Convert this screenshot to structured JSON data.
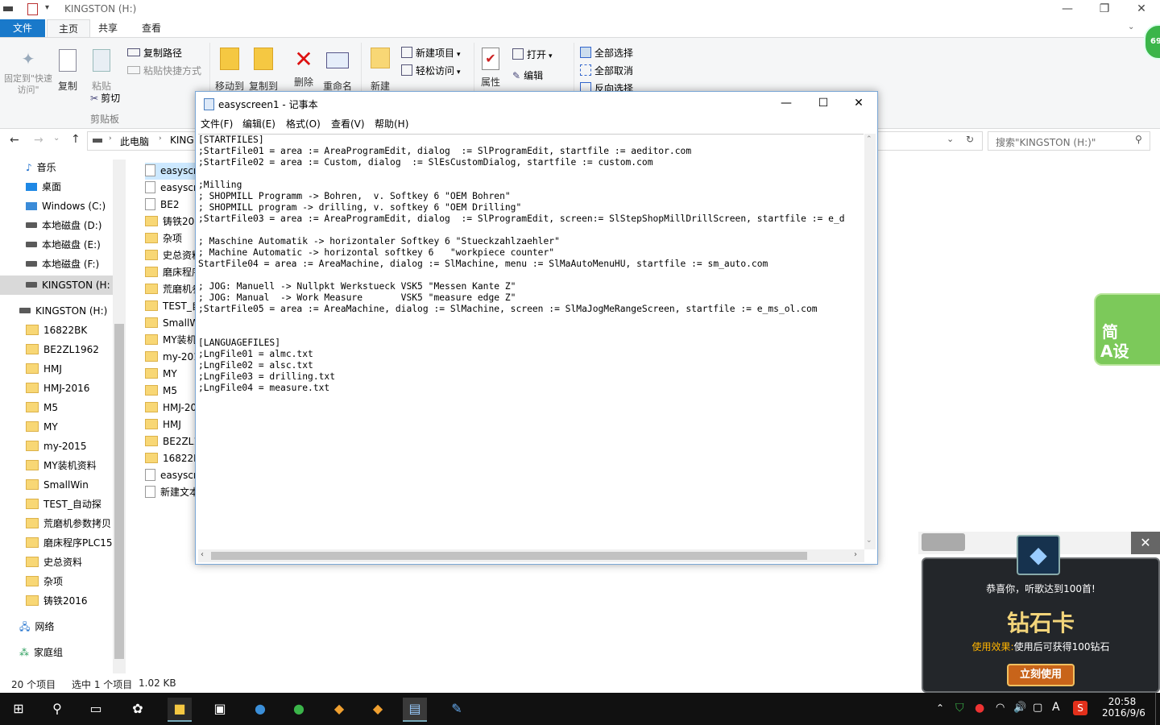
{
  "explorer": {
    "title": "KINGSTON (H:)",
    "tabs": [
      "文件",
      "主页",
      "共享",
      "查看"
    ],
    "ribbon": {
      "pin_quick_access": "固定到\"快速访问\"",
      "copy": "复制",
      "paste": "粘贴",
      "copy_path": "复制路径",
      "paste_shortcut": "粘贴快捷方式",
      "cut": "剪切",
      "clipboard_group": "剪贴板",
      "move_to": "移动到",
      "copy_to": "复制到",
      "delete": "删除",
      "rename": "重命名",
      "new_folder": "新建",
      "new_item": "新建项目",
      "easy_access": "轻松访问",
      "properties": "属性",
      "open": "打开",
      "edit": "编辑",
      "select_all": "全部选择",
      "select_none": "全部取消",
      "invert": "反向选择"
    },
    "address": {
      "pc": "此电脑",
      "drive": "KING"
    },
    "search_placeholder": "搜索\"KINGSTON (H:)\"",
    "nav": [
      {
        "label": "音乐",
        "kind": "music"
      },
      {
        "label": "桌面",
        "kind": "desktop"
      },
      {
        "label": "Windows (C:)",
        "kind": "drive"
      },
      {
        "label": "本地磁盘 (D:)",
        "kind": "drive"
      },
      {
        "label": "本地磁盘 (E:)",
        "kind": "drive"
      },
      {
        "label": "本地磁盘 (F:)",
        "kind": "drive"
      },
      {
        "label": "KINGSTON (H:",
        "kind": "drive"
      }
    ],
    "nav_tree": {
      "root": "KINGSTON (H:)",
      "children": [
        "16822BK",
        "BE2ZL1962",
        "HMJ",
        "HMJ-2016",
        "M5",
        "MY",
        "my-2015",
        "MY装机资料",
        "SmallWin",
        "TEST_自动探",
        "荒磨机参数拷贝",
        "磨床程序PLC15",
        "史总资料",
        "杂项",
        "铸铁2016"
      ],
      "network": "网络",
      "homegroup": "家庭组"
    },
    "files": [
      "easyscr",
      "easyscr",
      "BE2",
      "铸铁201",
      "杂项",
      "史总资料",
      "磨床程序",
      "荒磨机参",
      "TEST_自",
      "SmallWi",
      "MY装机",
      "my-2015",
      "MY",
      "M5",
      "HMJ-20",
      "HMJ",
      "BE2ZL19",
      "16822BI",
      "easyscr",
      "新建文本"
    ],
    "status": {
      "count": "20 个项目",
      "selected": "选中 1 个项目",
      "size": "1.02 KB"
    }
  },
  "notepad": {
    "title": "easyscreen1 - 记事本",
    "menu": [
      "文件(F)",
      "编辑(E)",
      "格式(O)",
      "查看(V)",
      "帮助(H)"
    ],
    "lines": [
      "[STARTFILES]",
      ";StartFile01 = area := AreaProgramEdit, dialog  := SlProgramEdit, startfile := aeditor.com",
      ";StartFile02 = area := Custom, dialog  := SlEsCustomDialog, startfile := custom.com",
      "",
      ";Milling",
      "; SHOPMILL Programm -> Bohren,  v. Softkey 6 \"OEM Bohren\"",
      "; SHOPMILL program -> drilling, v. softkey 6 \"OEM Drilling\"",
      ";StartFile03 = area := AreaProgramEdit, dialog  := SlProgramEdit, screen:= SlStepShopMillDrillScreen, startfile := e_d",
      "",
      "; Maschine Automatik -> horizontaler Softkey 6 \"Stueckzahlzaehler\"",
      "; Machine Automatic -> horizontal softkey 6   \"workpiece counter\"",
      "StartFile04 = area := AreaMachine, dialog := SlMachine, menu := SlMaAutoMenuHU, startfile := sm_auto.com",
      "",
      "; JOG: Manuell -> Nullpkt Werkstueck VSK5 \"Messen Kante Z\"",
      "; JOG: Manual  -> Work Measure       VSK5 \"measure edge Z\"",
      ";StartFile05 = area := AreaMachine, dialog := SlMachine, screen := SlMaJogMeRangeScreen, startfile := e_ms_ol.com",
      "",
      "",
      "[LANGUAGEFILES]",
      ";LngFile01 = almc.txt",
      ";LngFile02 = alsc.txt",
      ";LngFile03 = drilling.txt",
      ";LngFile04 = measure.txt"
    ]
  },
  "popup": {
    "congrats": "恭喜你，听歌达到100首!",
    "card": "钻石卡",
    "effect_label": "使用效果:",
    "effect": "使用后可获得100钻石",
    "use_btn": "立刻使用"
  },
  "side_widget": {
    "line1": "简",
    "line2": "A设"
  },
  "badge": "69",
  "taskbar": {
    "time": "20:58",
    "date": "2016/9/6",
    "ime": "A"
  }
}
